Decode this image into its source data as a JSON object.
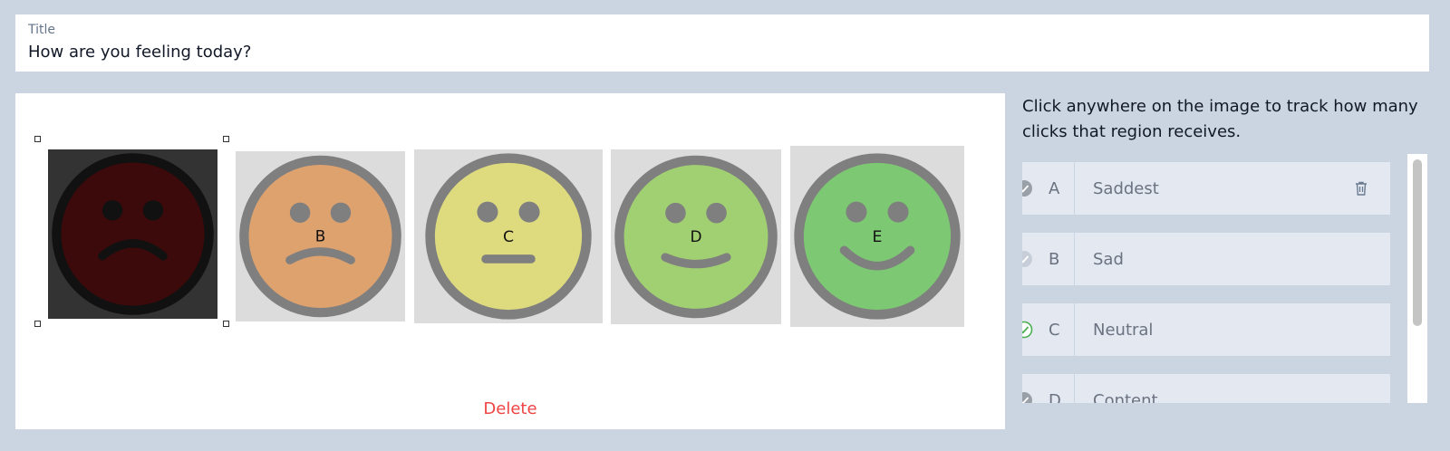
{
  "title_field": {
    "label": "Title",
    "value": "How are you feeling today?"
  },
  "canvas": {
    "delete_label": "Delete",
    "regions": [
      {
        "key": "A",
        "label": "",
        "fill": "#3c0a0a",
        "ring": "#111111",
        "features": "#111111",
        "mouth": "frown-deep",
        "selected": true
      },
      {
        "key": "B",
        "label": "B",
        "fill": "#dea26f",
        "ring": "#7f7f7f",
        "features": "#7f7f7f",
        "mouth": "frown"
      },
      {
        "key": "C",
        "label": "C",
        "fill": "#dedb7e",
        "ring": "#7f7f7f",
        "features": "#7f7f7f",
        "mouth": "flat"
      },
      {
        "key": "D",
        "label": "D",
        "fill": "#a1d072",
        "ring": "#7f7f7f",
        "features": "#7f7f7f",
        "mouth": "smile"
      },
      {
        "key": "E",
        "label": "E",
        "fill": "#7dc872",
        "ring": "#7f7f7f",
        "features": "#7f7f7f",
        "mouth": "smile-big"
      }
    ]
  },
  "panel": {
    "instructions": "Click anywhere on the image to track how many clicks that region receives.",
    "items": [
      {
        "key": "A",
        "label": "Saddest",
        "active": true,
        "check": "gray"
      },
      {
        "key": "B",
        "label": "Sad",
        "active": false,
        "check": "light"
      },
      {
        "key": "C",
        "label": "Neutral",
        "active": false,
        "check": "green"
      },
      {
        "key": "D",
        "label": "Content",
        "active": false,
        "check": "gray"
      }
    ]
  },
  "colors": {
    "background": "#cbd5e1",
    "delete": "#ef4444",
    "check_green": "#4caf50"
  }
}
